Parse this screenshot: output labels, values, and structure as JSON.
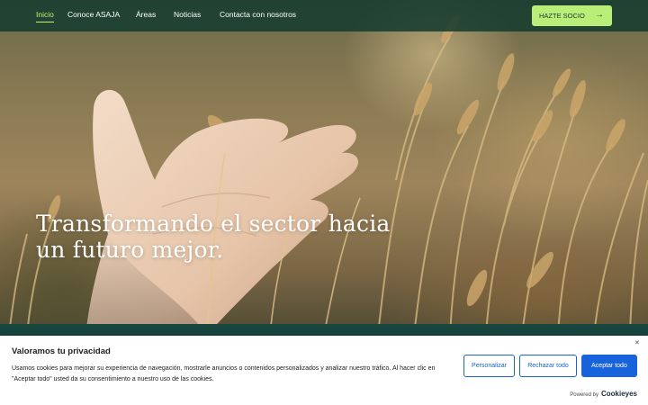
{
  "nav": {
    "items": [
      {
        "label": "Inicio",
        "active": true
      },
      {
        "label": "Conoce ASAJA",
        "active": false
      },
      {
        "label": "Áreas",
        "active": false
      },
      {
        "label": "Noticias",
        "active": false
      },
      {
        "label": "Contacta con nosotros",
        "active": false
      }
    ],
    "cta_label": "HAZTE SOCIO",
    "cta_icon": "arrow-right-icon"
  },
  "hero": {
    "headline": "Transformando el sector hacia un futuro mejor."
  },
  "cookie_banner": {
    "title": "Valoramos tu privacidad",
    "text": "Usamos cookies para mejorar su experiencia de navegación, mostrarle anuncios o contenidos personalizados y analizar nuestro tráfico. Al hacer clic en \"Aceptar todo\" usted da su consentimiento a nuestro uso de las cookies.",
    "close_icon": "close-icon",
    "customize_label": "Personalizar",
    "reject_label": "Rechazar todo",
    "accept_label": "Aceptar todo",
    "powered_by": "Powered by",
    "powered_brand": "Cookieyes"
  },
  "colors": {
    "nav_bg": "#173c30",
    "accent_green": "#b9ee79",
    "active_link": "#c7f06b",
    "cookie_blue": "#1863dc"
  }
}
